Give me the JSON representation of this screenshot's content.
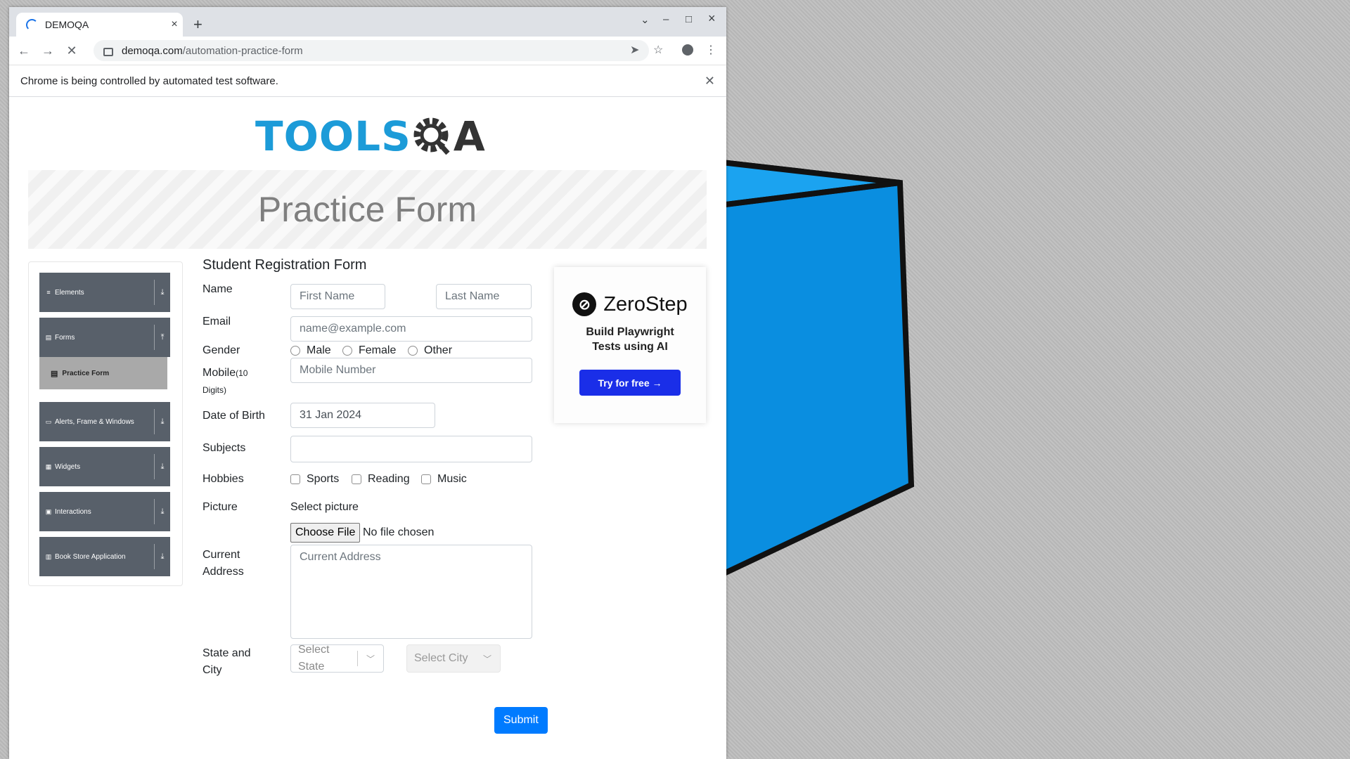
{
  "browser": {
    "tab_title": "DEMOQA",
    "new_tab": "+",
    "tab_close": "×",
    "url_host": "demoqa.com",
    "url_path": "/automation-practice-form",
    "infobar_text": "Chrome is being controlled by automated test software.",
    "window_controls": {
      "dropdown": "⌄",
      "minimize": "–",
      "maximize": "□",
      "close": "×"
    }
  },
  "page": {
    "logo_text_left": "TOOLS",
    "logo_text_right": "A",
    "banner_title": "Practice Form"
  },
  "sidebar": {
    "groups": [
      {
        "icon": "≡",
        "label": "Elements",
        "arrow": "⤓"
      },
      {
        "icon": "▤",
        "label": "Forms",
        "arrow": "⤒"
      },
      {
        "icon": "▭",
        "label": "Alerts, Frame & Windows",
        "arrow": "⤓"
      },
      {
        "icon": "▦",
        "label": "Widgets",
        "arrow": "⤓"
      },
      {
        "icon": "▣",
        "label": "Interactions",
        "arrow": "⤓"
      },
      {
        "icon": "▥",
        "label": "Book Store Application",
        "arrow": "⤓"
      }
    ],
    "active_item": {
      "icon": "▤",
      "label": "Practice Form"
    }
  },
  "form": {
    "title": "Student Registration Form",
    "name_label": "Name",
    "first_name_placeholder": "First Name",
    "last_name_placeholder": "Last Name",
    "email_label": "Email",
    "email_placeholder": "name@example.com",
    "gender_label": "Gender",
    "gender_options": [
      "Male",
      "Female",
      "Other"
    ],
    "mobile_label": "Mobile",
    "mobile_hint_a": "(10",
    "mobile_hint_b": "Digits)",
    "mobile_placeholder": "Mobile Number",
    "dob_label": "Date of Birth",
    "dob_value": "31 Jan 2024",
    "subjects_label": "Subjects",
    "hobbies_label": "Hobbies",
    "hobbies_options": [
      "Sports",
      "Reading",
      "Music"
    ],
    "picture_label": "Picture",
    "select_picture": "Select picture",
    "choose_file": "Choose File",
    "no_file": "No file chosen",
    "address_label_a": "Current",
    "address_label_b": "Address",
    "address_placeholder": "Current Address",
    "state_city_label_a": "State and",
    "state_city_label_b": "City",
    "state_placeholder_a": "Select",
    "state_placeholder_b": "State",
    "city_placeholder": "Select City",
    "submit": "Submit"
  },
  "ad": {
    "brand": "ZeroStep",
    "tagline": "Build Playwright Tests using AI",
    "cta": "Try for free →"
  },
  "colors": {
    "accent": "#007bff",
    "logo_blue": "#1c9bd8",
    "sidebar_group": "#58606a",
    "cube_blue": "#0a8ee0"
  }
}
